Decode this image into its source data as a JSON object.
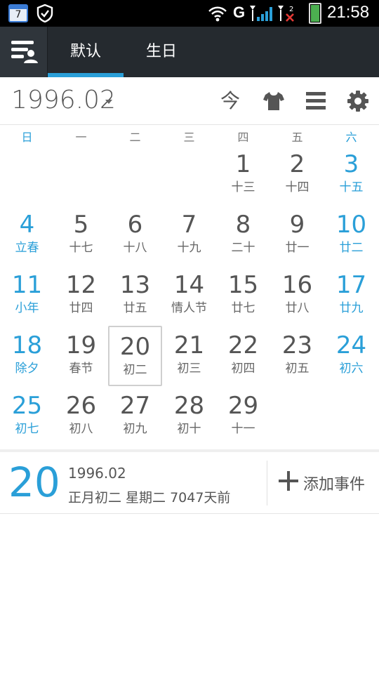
{
  "status_bar": {
    "calendar_badge": "7",
    "network": "G",
    "time": "21:58",
    "colors": {
      "battery": "#4caf50",
      "background": "#000000"
    }
  },
  "tabs": [
    {
      "label": "默认",
      "selected": true
    },
    {
      "label": "生日",
      "selected": false
    }
  ],
  "toolbar": {
    "month_label": "1996.02",
    "today_glyph": "今",
    "icons": [
      "today-icon",
      "shirt-icon",
      "list-icon",
      "gear-icon"
    ]
  },
  "weekdays": [
    "日",
    "一",
    "二",
    "三",
    "四",
    "五",
    "六"
  ],
  "calendar": {
    "selected_day": "20",
    "weeks": [
      [
        null,
        null,
        null,
        null,
        {
          "d": "1",
          "l": "十三"
        },
        {
          "d": "2",
          "l": "十四"
        },
        {
          "d": "3",
          "l": "十五"
        }
      ],
      [
        {
          "d": "4",
          "l": "立春"
        },
        {
          "d": "5",
          "l": "十七"
        },
        {
          "d": "6",
          "l": "十八"
        },
        {
          "d": "7",
          "l": "十九"
        },
        {
          "d": "8",
          "l": "二十"
        },
        {
          "d": "9",
          "l": "廿一"
        },
        {
          "d": "10",
          "l": "廿二"
        }
      ],
      [
        {
          "d": "11",
          "l": "小年"
        },
        {
          "d": "12",
          "l": "廿四"
        },
        {
          "d": "13",
          "l": "廿五"
        },
        {
          "d": "14",
          "l": "情人节"
        },
        {
          "d": "15",
          "l": "廿七"
        },
        {
          "d": "16",
          "l": "廿八"
        },
        {
          "d": "17",
          "l": "廿九"
        }
      ],
      [
        {
          "d": "18",
          "l": "除夕"
        },
        {
          "d": "19",
          "l": "春节"
        },
        {
          "d": "20",
          "l": "初二"
        },
        {
          "d": "21",
          "l": "初三"
        },
        {
          "d": "22",
          "l": "初四"
        },
        {
          "d": "23",
          "l": "初五"
        },
        {
          "d": "24",
          "l": "初六"
        }
      ],
      [
        {
          "d": "25",
          "l": "初七"
        },
        {
          "d": "26",
          "l": "初八"
        },
        {
          "d": "27",
          "l": "初九"
        },
        {
          "d": "28",
          "l": "初十"
        },
        {
          "d": "29",
          "l": "十一"
        },
        null,
        null
      ]
    ]
  },
  "detail": {
    "day": "20",
    "month": "1996.02",
    "info": "正月初二 星期二 7047天前",
    "add_event_label": "添加事件"
  },
  "colors": {
    "accent": "#2a9fd8",
    "appbar": "#252a2f",
    "text": "#555555"
  }
}
